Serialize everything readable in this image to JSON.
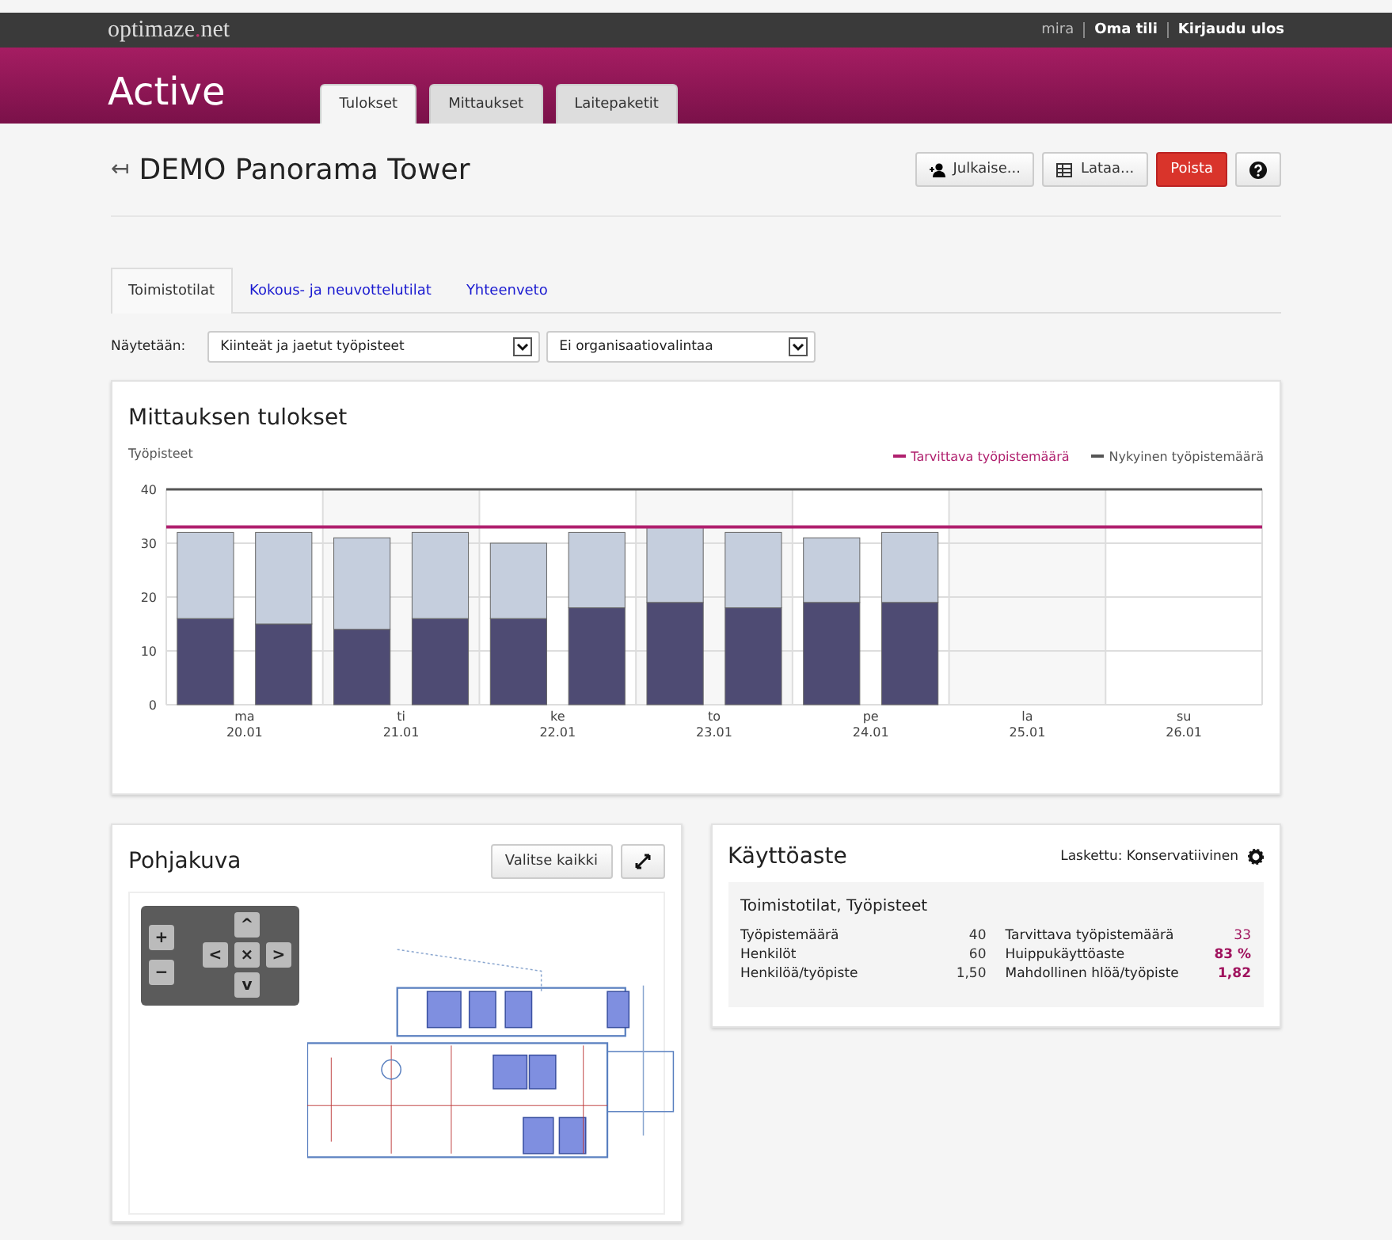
{
  "topbar": {
    "logo_main": "optimaze",
    "logo_dot": ".",
    "logo_tld": "net",
    "user": "mira",
    "links": [
      "Oma tili",
      "Kirjaudu ulos"
    ]
  },
  "header": {
    "title": "Active",
    "tabs": [
      {
        "label": "Tulokset",
        "selected": true
      },
      {
        "label": "Mittaukset",
        "selected": false
      },
      {
        "label": "Laitepaketit",
        "selected": false
      }
    ]
  },
  "page": {
    "back": "↤",
    "title": "DEMO Panorama Tower",
    "actions": [
      {
        "kind": "publish",
        "label": "Julkaise..."
      },
      {
        "kind": "download",
        "label": "Lataa..."
      },
      {
        "kind": "delete",
        "label": "Poista"
      },
      {
        "kind": "help"
      }
    ]
  },
  "subtabs": [
    {
      "label": "Toimistotilat",
      "selected": true
    },
    {
      "label": "Kokous- ja neuvottelutilat",
      "selected": false
    },
    {
      "label": "Yhteenveto",
      "selected": false
    }
  ],
  "filter": {
    "label": "Näytetään:",
    "selects": [
      "Kiinteät ja jaetut työpisteet",
      "Ei organisaatiovalintaa"
    ]
  },
  "results": {
    "title": "Mittauksen tulokset",
    "chart_data": {
      "type": "bar",
      "stacked": true,
      "ylabel": "Työpisteet",
      "grid": true,
      "categories": [
        "ma 20.01",
        null,
        "ti 21.01",
        null,
        "ke 22.01",
        null,
        "to 23.01",
        null,
        "pe 24.01",
        null,
        "la 25.01",
        null,
        "su 26.01",
        null
      ],
      "ylim": [
        0,
        40
      ],
      "yticks": [
        0,
        10,
        20,
        30,
        40
      ],
      "series": [
        {
          "color": "#4e4b73",
          "values": [
            16,
            15,
            14,
            16,
            16,
            18,
            19,
            18,
            19,
            19,
            null,
            null,
            null,
            null
          ]
        },
        {
          "color": "#c5cedd",
          "values": [
            16,
            17,
            17,
            16,
            14,
            14,
            14,
            14,
            12,
            13,
            null,
            null,
            null,
            null
          ]
        }
      ],
      "ref_lines": [
        {
          "label": "Tarvittava työpistemäärä",
          "color": "#b0206e",
          "axis": "y",
          "value": 33
        },
        {
          "label": "Nykyinen työpistemäärä",
          "color": "#555555",
          "axis": "y",
          "value": 40
        }
      ]
    }
  },
  "floorplan": {
    "title": "Pohjakuva",
    "select_all": "Valitse kaikki",
    "zoom_in": "+",
    "zoom_out": "−",
    "pan": [
      "^",
      "<",
      "×",
      ">",
      "v"
    ]
  },
  "usage": {
    "title": "Käyttöaste",
    "calc": "Laskettu: Konservatiivinen",
    "subtitle": "Toimistotilat, Työpisteet",
    "left": [
      {
        "label": "Työpistemäärä",
        "value": "40"
      },
      {
        "label": "Henkilöt",
        "value": "60"
      },
      {
        "label": "Henkilöä/työpiste",
        "value": "1,50"
      }
    ],
    "right": [
      {
        "label": "Tarvittava työpistemäärä",
        "value": "33",
        "bold": false
      },
      {
        "label": "Huippukäyttöaste",
        "value": "83 %",
        "bold": true
      },
      {
        "label": "Mahdollinen hlöä/työpiste",
        "value": "1,82",
        "bold": true
      }
    ]
  }
}
